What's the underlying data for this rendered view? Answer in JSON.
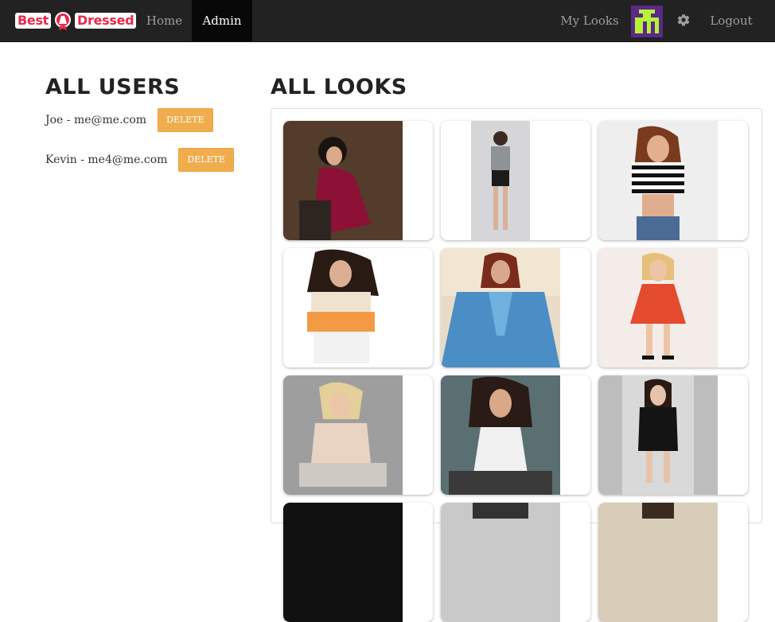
{
  "navbar": {
    "brand_left": "Best",
    "brand_right": "Dressed",
    "items": [
      {
        "label": "Home"
      },
      {
        "label": "Admin",
        "active": true
      }
    ],
    "right_items": {
      "my_looks": "My Looks",
      "logout": "Logout",
      "settings_icon": "gear-icon",
      "avatar_icon": "pixel-avatar"
    },
    "avatar_colors": {
      "bg": "#5b2a86",
      "fg": "#b6f23a"
    }
  },
  "users": {
    "title": "ALL USERS",
    "list": [
      {
        "label": "Joe - me@me.com",
        "button": "DELETE"
      },
      {
        "label": "Kevin - me4@me.com",
        "button": "DELETE"
      }
    ]
  },
  "looks": {
    "title": "ALL LOOKS",
    "cards": [
      {
        "name": "look-1"
      },
      {
        "name": "look-2"
      },
      {
        "name": "look-3"
      },
      {
        "name": "look-4"
      },
      {
        "name": "look-5"
      },
      {
        "name": "look-6"
      },
      {
        "name": "look-7"
      },
      {
        "name": "look-8"
      },
      {
        "name": "look-9"
      },
      {
        "name": "look-10"
      },
      {
        "name": "look-11"
      },
      {
        "name": "look-12"
      }
    ]
  },
  "colors": {
    "navbar": "#222222",
    "navbar_active": "#080808",
    "accent_warning": "#f0ad4e",
    "brand_red": "#e8294a"
  }
}
